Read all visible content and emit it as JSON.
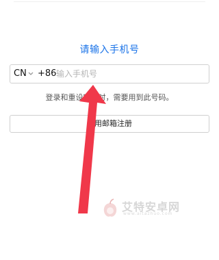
{
  "page": {
    "title": "请输入手机号",
    "phone": {
      "country_code": "CN",
      "dial_code": "+86",
      "placeholder": "输入手机号",
      "value": ""
    },
    "hint": "登录和重设密码时，需要用到此号码。",
    "email_button_label": "使用邮箱注册"
  },
  "watermark": {
    "text": "艾特安卓网",
    "url": "www.aitazhuo.com"
  },
  "colors": {
    "accent": "#1a73e8",
    "arrow": "#f0384a"
  },
  "icons": {
    "country_dropdown": "chevron-down-icon",
    "annotation": "arrow-annotation",
    "watermark_logo": "fruit-logo-icon"
  }
}
